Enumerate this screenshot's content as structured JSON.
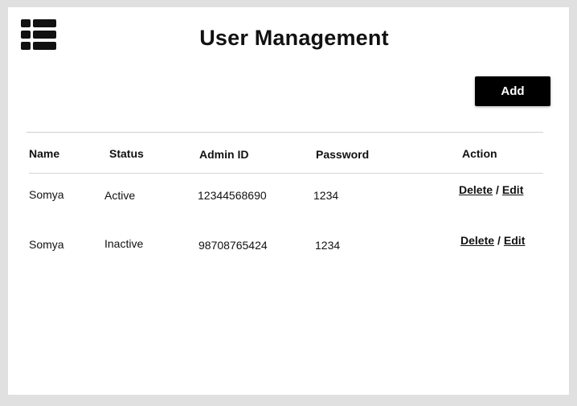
{
  "header": {
    "menu_icon": "list-icon",
    "title": "User Management"
  },
  "toolbar": {
    "add_label": "Add"
  },
  "table": {
    "columns": [
      "Name",
      "Status",
      "Admin ID",
      "Password",
      "Action"
    ],
    "rows": [
      {
        "name": "Somya",
        "status": "Active",
        "admin_id": "12344568690",
        "password": "1234",
        "delete_label": "Delete",
        "separator": "/",
        "edit_label": "Edit"
      },
      {
        "name": "Somya",
        "status": "Inactive",
        "admin_id": "98708765424",
        "password": "1234",
        "delete_label": "Delete",
        "separator": "/",
        "edit_label": "Edit"
      }
    ]
  },
  "colors": {
    "background": "#e0e0e0",
    "panel": "#ffffff",
    "button": "#000000",
    "button_text": "#ffffff",
    "text": "#111111"
  }
}
